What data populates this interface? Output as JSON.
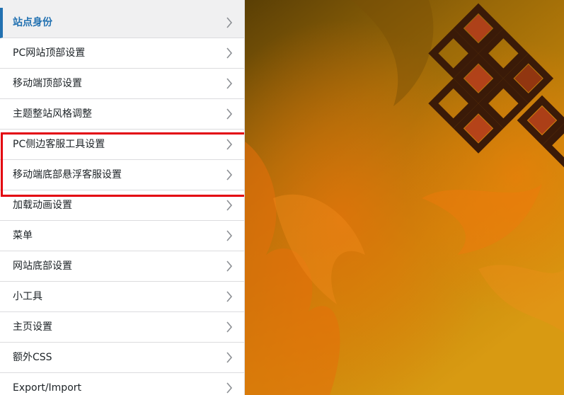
{
  "sidebar": {
    "items": [
      {
        "label": "站点身份",
        "active": true
      },
      {
        "label": "PC网站顶部设置"
      },
      {
        "label": "移动端顶部设置"
      },
      {
        "label": "主题整站风格调整"
      },
      {
        "label": "PC侧边客服工具设置"
      },
      {
        "label": "移动端底部悬浮客服设置"
      },
      {
        "label": "加载动画设置"
      },
      {
        "label": "菜单"
      },
      {
        "label": "网站底部设置"
      },
      {
        "label": "小工具"
      },
      {
        "label": "主页设置"
      },
      {
        "label": "额外CSS"
      },
      {
        "label": "Export/Import"
      }
    ],
    "chevron_icon": "chevron-right-icon",
    "highlighted_items": [
      4,
      5
    ]
  },
  "colors": {
    "active_accent": "#2271b1",
    "highlight_border": "#e3000f",
    "preview_base": "#c8870a"
  }
}
